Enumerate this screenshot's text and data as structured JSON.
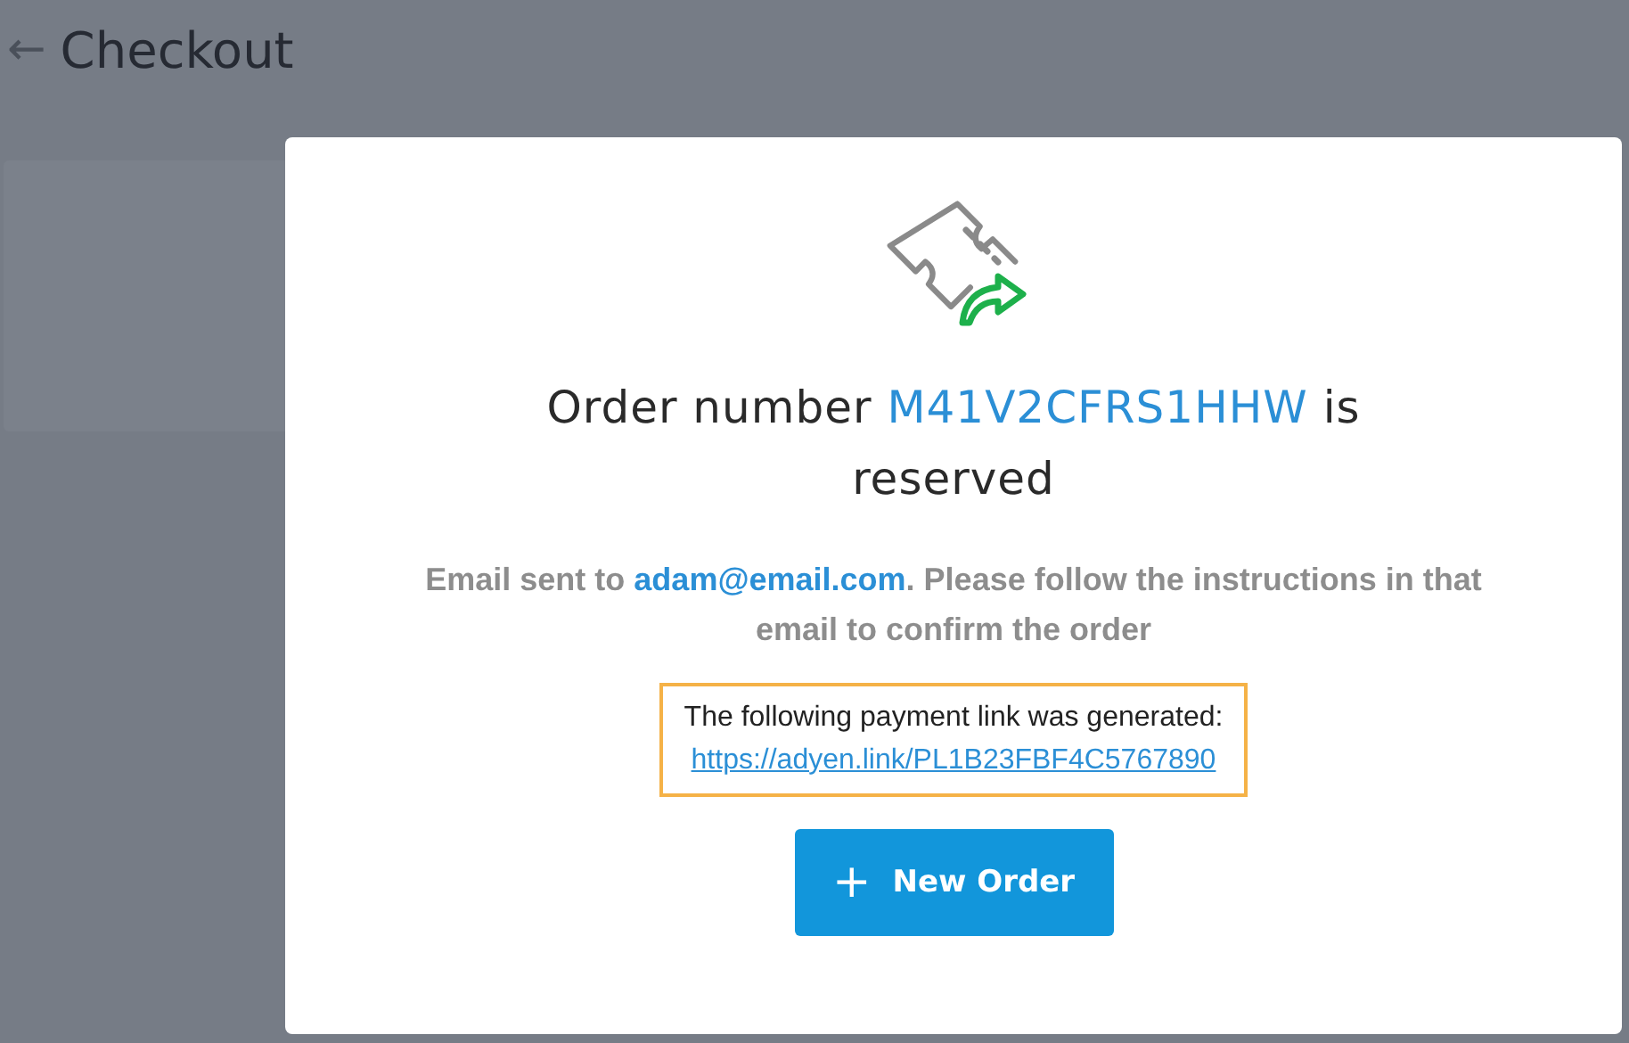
{
  "header": {
    "back_icon": "←",
    "title": "Checkout"
  },
  "dialog": {
    "heading": {
      "before": "Order number ",
      "order_number": "M41V2CFRS1HHW",
      "after": " is reserved"
    },
    "message": {
      "before": "Email sent to ",
      "email": "adam@email.com",
      "after": ". Please follow the instructions in that email to confirm the order"
    },
    "payment_notice": {
      "text": "The following payment link was generated:",
      "link": "https://adyen.link/PL1B23FBF4C5767890"
    },
    "button": {
      "icon": "+",
      "label": "New Order"
    }
  }
}
